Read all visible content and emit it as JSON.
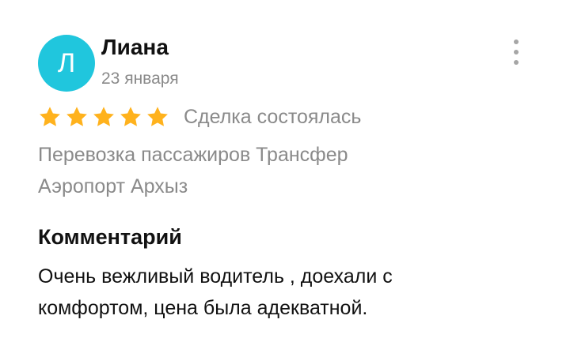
{
  "review": {
    "author": {
      "initial": "Л",
      "name": "Лиана",
      "avatar_color": "#20c6dd"
    },
    "date": "23 января",
    "menu_icon": "more-vertical-icon",
    "rating": {
      "stars": 5,
      "max": 5,
      "star_color": "#ffb21d",
      "icon": "star-icon"
    },
    "deal_status": "Сделка состоялась",
    "service_line1": "Перевозка пассажиров Трансфер",
    "service_line2": "Аэропорт Архыз",
    "comment_heading": "Комментарий",
    "comment_line1": "Очень вежливый водитель , доехали с",
    "comment_line2": "комфортом, цена была адекватной."
  }
}
